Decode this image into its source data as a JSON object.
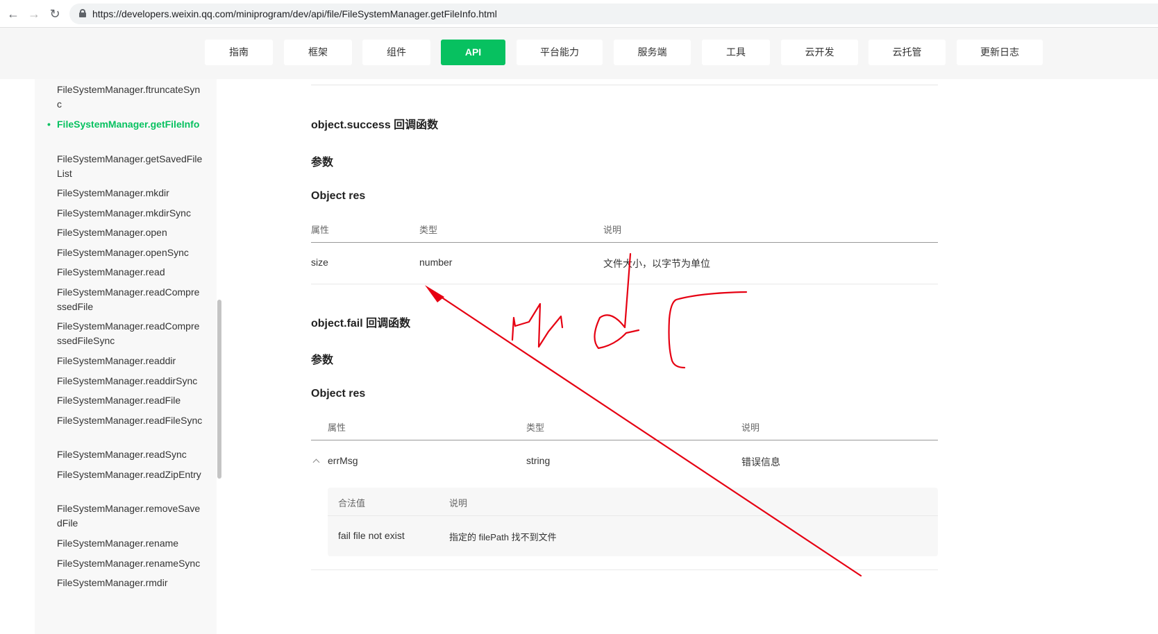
{
  "browser": {
    "back_icon": "arrow-left-icon",
    "forward_icon": "arrow-right-icon",
    "reload_icon": "reload-icon",
    "url": "https://developers.weixin.qq.com/miniprogram/dev/api/file/FileSystemManager.getFileInfo.html"
  },
  "top_nav": {
    "tabs": [
      "指南",
      "框架",
      "组件",
      "API",
      "平台能力",
      "服务端",
      "工具",
      "云开发",
      "云托管",
      "更新日志"
    ],
    "active": "API",
    "accent_color": "#07c160"
  },
  "sidebar": {
    "items": [
      "FileSystemManager.ftruncateSync",
      "FileSystemManager.getFileInfo",
      "FileSystemManager.getSavedFileList",
      "FileSystemManager.mkdir",
      "FileSystemManager.mkdirSync",
      "FileSystemManager.open",
      "FileSystemManager.openSync",
      "FileSystemManager.read",
      "FileSystemManager.readCompressedFile",
      "FileSystemManager.readCompressedFileSync",
      "FileSystemManager.readdir",
      "FileSystemManager.readdirSync",
      "FileSystemManager.readFile",
      "FileSystemManager.readFileSync",
      "FileSystemManager.readSync",
      "FileSystemManager.readZipEntry",
      "FileSystemManager.removeSavedFile",
      "FileSystemManager.rename",
      "FileSystemManager.renameSync",
      "FileSystemManager.rmdir"
    ],
    "active_index": 1
  },
  "main": {
    "success": {
      "title": "object.success 回调函数",
      "params_label": "参数",
      "object_label": "Object res",
      "headers": [
        "属性",
        "类型",
        "说明"
      ],
      "rows": [
        [
          "size",
          "number",
          "文件大小，以字节为单位"
        ]
      ]
    },
    "fail": {
      "title": "object.fail 回调函数",
      "params_label": "参数",
      "object_label": "Object res",
      "headers": [
        "属性",
        "类型",
        "说明"
      ],
      "rows": [
        [
          "errMsg",
          "string",
          "错误信息"
        ]
      ],
      "expand_icon": "chevron-up-icon",
      "sub_table": {
        "headers": [
          "合法值",
          "说明"
        ],
        "rows": [
          [
            "fail file not exist",
            "指定的 filePath 找不到文件"
          ]
        ]
      }
    }
  },
  "annotation": {
    "color": "#e60012",
    "handwriting": "md5",
    "arrow_icon": "red-arrow"
  }
}
